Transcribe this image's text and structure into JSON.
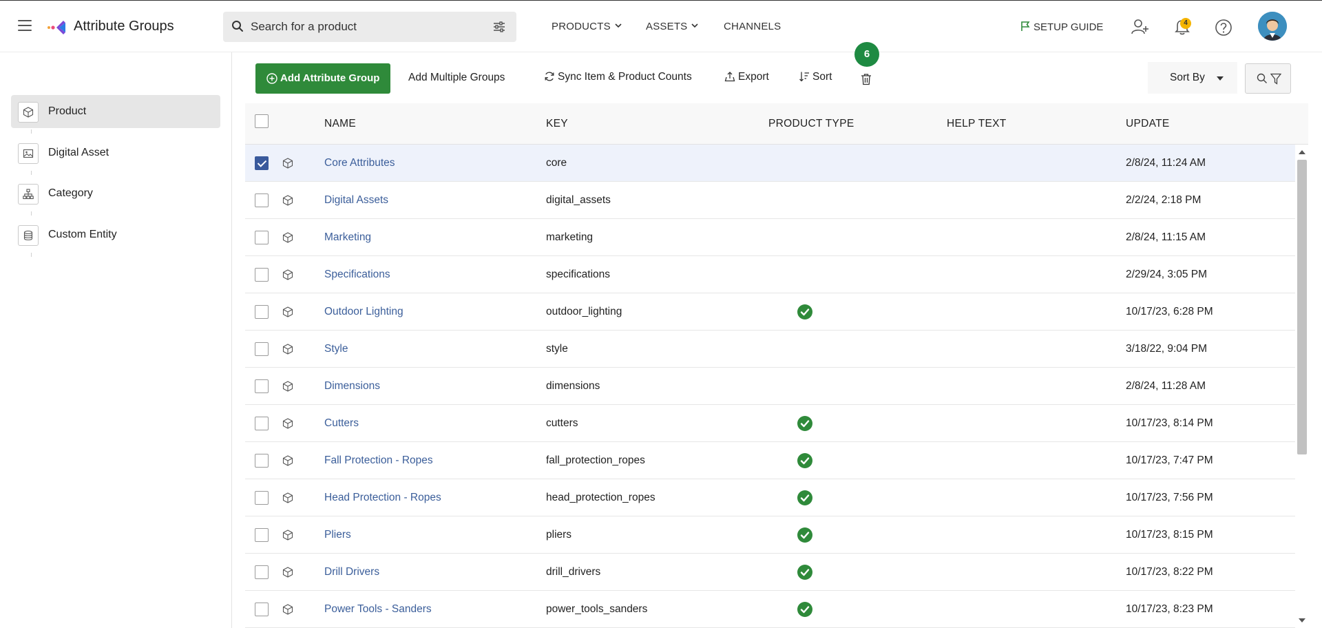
{
  "header": {
    "app_title": "Attribute Groups",
    "search_placeholder": "Search for a product",
    "nav": [
      {
        "label": "PRODUCTS"
      },
      {
        "label": "ASSETS"
      },
      {
        "label": "CHANNELS"
      }
    ],
    "setup_guide": "SETUP GUIDE",
    "notification_count": "4"
  },
  "sidebar": {
    "items": [
      {
        "label": "Product",
        "icon": "cube-icon",
        "active": true
      },
      {
        "label": "Digital Asset",
        "icon": "image-icon",
        "active": false
      },
      {
        "label": "Category",
        "icon": "hierarchy-icon",
        "active": false
      },
      {
        "label": "Custom Entity",
        "icon": "database-icon",
        "active": false
      }
    ]
  },
  "toolbar": {
    "add_group": "Add Attribute Group",
    "add_multiple": "Add Multiple Groups",
    "sync": "Sync Item & Product Counts",
    "export": "Export",
    "sort": "Sort",
    "selected_count": "6",
    "sort_by": "Sort By"
  },
  "table": {
    "columns": [
      "NAME",
      "KEY",
      "PRODUCT TYPE",
      "HELP TEXT",
      "UPDATE"
    ],
    "rows": [
      {
        "name": "Core Attributes",
        "key": "core",
        "product_type": false,
        "help_text": "",
        "updated": "2/8/24, 11:24 AM",
        "checked": true
      },
      {
        "name": "Digital Assets",
        "key": "digital_assets",
        "product_type": false,
        "help_text": "",
        "updated": "2/2/24, 2:18 PM",
        "checked": false
      },
      {
        "name": "Marketing",
        "key": "marketing",
        "product_type": false,
        "help_text": "",
        "updated": "2/8/24, 11:15 AM",
        "checked": false
      },
      {
        "name": "Specifications",
        "key": "specifications",
        "product_type": false,
        "help_text": "",
        "updated": "2/29/24, 3:05 PM",
        "checked": false
      },
      {
        "name": "Outdoor Lighting",
        "key": "outdoor_lighting",
        "product_type": true,
        "help_text": "",
        "updated": "10/17/23, 6:28 PM",
        "checked": false
      },
      {
        "name": "Style",
        "key": "style",
        "product_type": false,
        "help_text": "",
        "updated": "3/18/22, 9:04 PM",
        "checked": false
      },
      {
        "name": "Dimensions",
        "key": "dimensions",
        "product_type": false,
        "help_text": "",
        "updated": "2/8/24, 11:28 AM",
        "checked": false
      },
      {
        "name": "Cutters",
        "key": "cutters",
        "product_type": true,
        "help_text": "",
        "updated": "10/17/23, 8:14 PM",
        "checked": false
      },
      {
        "name": "Fall Protection - Ropes",
        "key": "fall_protection_ropes",
        "product_type": true,
        "help_text": "",
        "updated": "10/17/23, 7:47 PM",
        "checked": false
      },
      {
        "name": "Head Protection - Ropes",
        "key": "head_protection_ropes",
        "product_type": true,
        "help_text": "",
        "updated": "10/17/23, 7:56 PM",
        "checked": false
      },
      {
        "name": "Pliers",
        "key": "pliers",
        "product_type": true,
        "help_text": "",
        "updated": "10/17/23, 8:15 PM",
        "checked": false
      },
      {
        "name": "Drill Drivers",
        "key": "drill_drivers",
        "product_type": true,
        "help_text": "",
        "updated": "10/17/23, 8:22 PM",
        "checked": false
      },
      {
        "name": "Power Tools - Sanders",
        "key": "power_tools_sanders",
        "product_type": true,
        "help_text": "",
        "updated": "10/17/23, 8:23 PM",
        "checked": false
      }
    ]
  },
  "colors": {
    "primary_green": "#2f8a3a",
    "link_blue": "#3b5e9a",
    "checkbox_blue": "#3a5a9c",
    "badge_yellow": "#f5b400"
  }
}
